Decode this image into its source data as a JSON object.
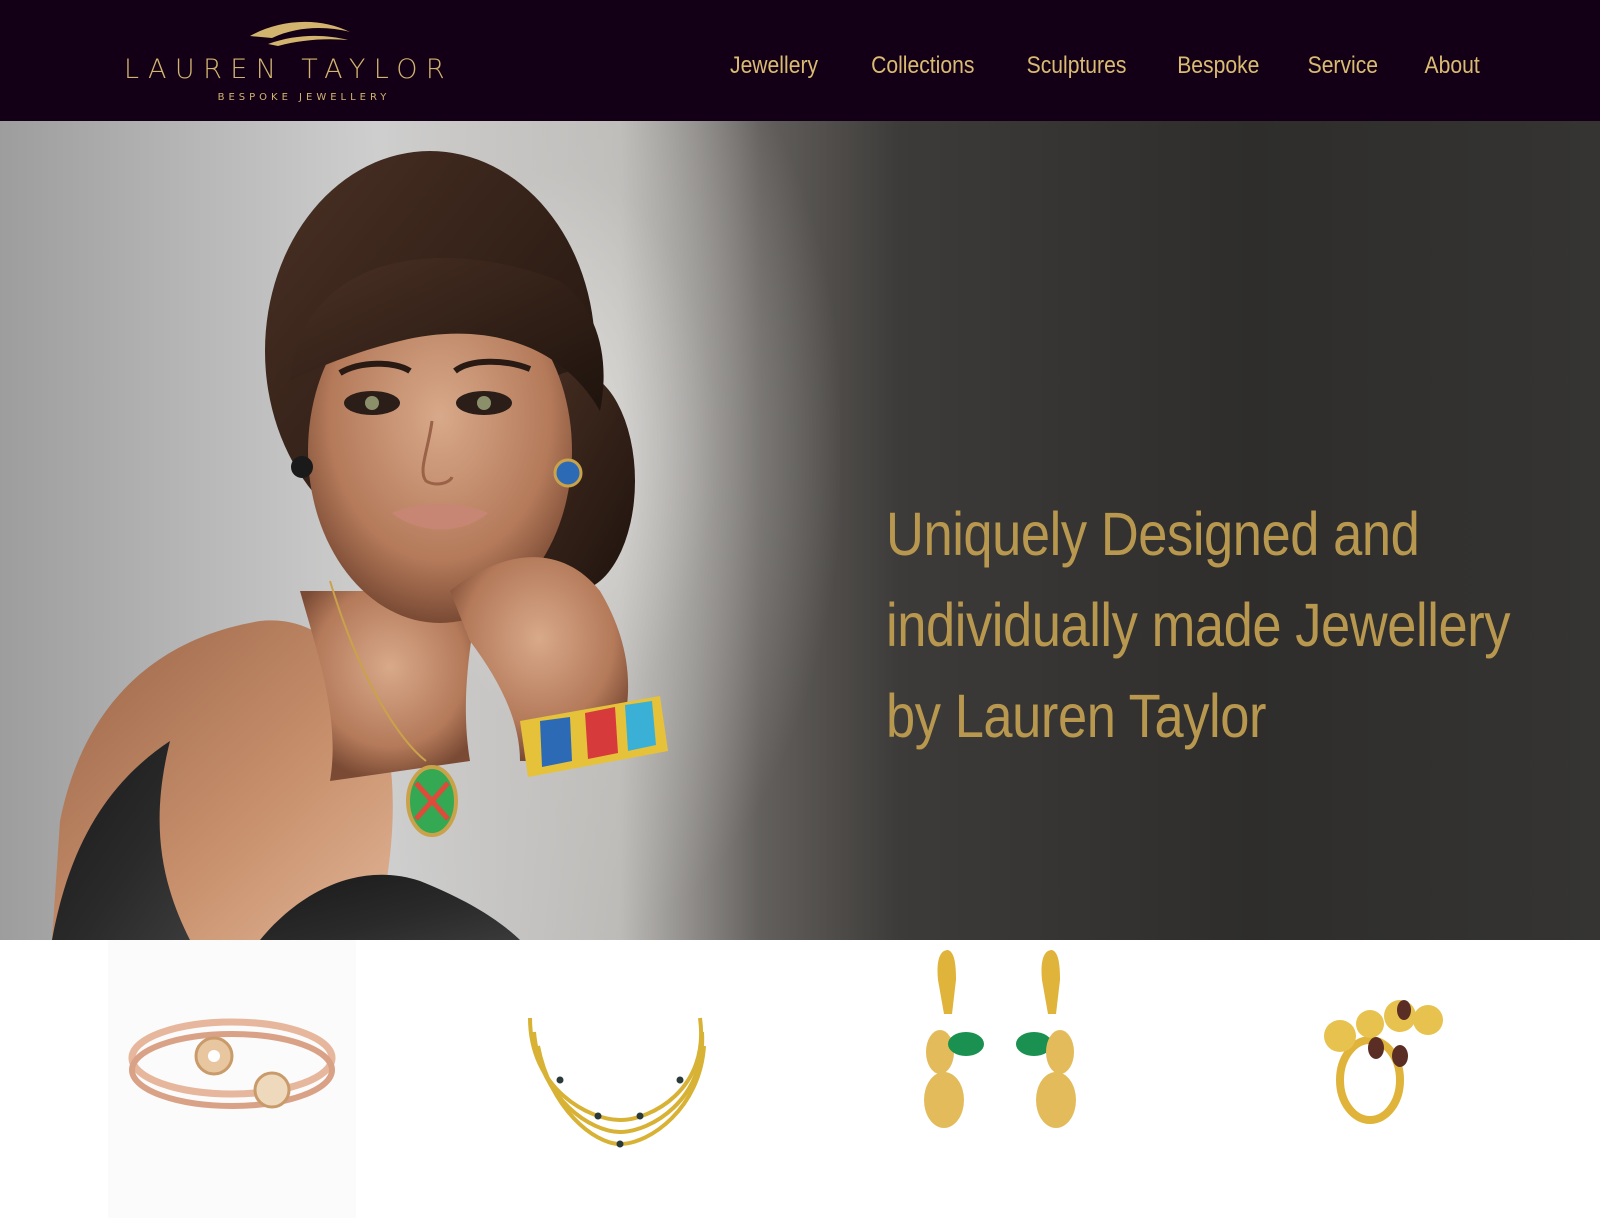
{
  "brand": {
    "name": "LAUREN TAYLOR",
    "tagline": "BESPOKE JEWELLERY",
    "color": "#d2b46f"
  },
  "nav": {
    "items": [
      {
        "label": "Jewellery"
      },
      {
        "label": "Collections"
      },
      {
        "label": "Sculptures"
      },
      {
        "label": "Bespoke"
      },
      {
        "label": "Service"
      },
      {
        "label": "About"
      }
    ]
  },
  "hero": {
    "lines": [
      "Uniquely Designed and",
      "individually made Jewellery",
      "by Lauren Taylor"
    ],
    "text_color": "#b8974e"
  },
  "products": [
    {
      "icon": "bangle-icon"
    },
    {
      "icon": "necklace-icon"
    },
    {
      "icon": "earrings-icon"
    },
    {
      "icon": "ring-icon"
    }
  ],
  "colors": {
    "header_bg": "#130017",
    "nav_text": "#d9bb72"
  }
}
